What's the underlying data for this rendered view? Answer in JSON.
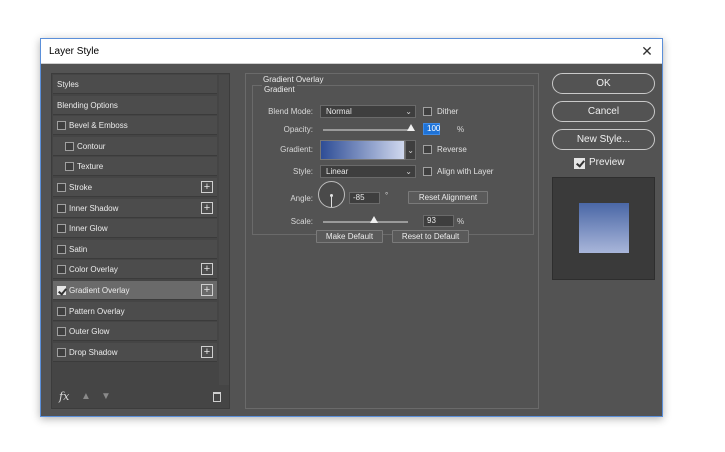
{
  "window": {
    "title": "Layer Style"
  },
  "sidebar": {
    "items": [
      {
        "label": "Styles",
        "checkbox": false,
        "indent": 0,
        "plus": false,
        "active": false
      },
      {
        "label": "Blending Options",
        "checkbox": false,
        "indent": 0,
        "plus": false,
        "active": false
      },
      {
        "label": "Bevel & Emboss",
        "checkbox": true,
        "checked": false,
        "indent": 0,
        "plus": false,
        "active": false
      },
      {
        "label": "Contour",
        "checkbox": true,
        "checked": false,
        "indent": 1,
        "plus": false,
        "active": false
      },
      {
        "label": "Texture",
        "checkbox": true,
        "checked": false,
        "indent": 1,
        "plus": false,
        "active": false
      },
      {
        "label": "Stroke",
        "checkbox": true,
        "checked": false,
        "indent": 0,
        "plus": true,
        "active": false
      },
      {
        "label": "Inner Shadow",
        "checkbox": true,
        "checked": false,
        "indent": 0,
        "plus": true,
        "active": false
      },
      {
        "label": "Inner Glow",
        "checkbox": true,
        "checked": false,
        "indent": 0,
        "plus": false,
        "active": false
      },
      {
        "label": "Satin",
        "checkbox": true,
        "checked": false,
        "indent": 0,
        "plus": false,
        "active": false
      },
      {
        "label": "Color Overlay",
        "checkbox": true,
        "checked": false,
        "indent": 0,
        "plus": true,
        "active": false
      },
      {
        "label": "Gradient Overlay",
        "checkbox": true,
        "checked": true,
        "indent": 0,
        "plus": true,
        "active": true
      },
      {
        "label": "Pattern Overlay",
        "checkbox": true,
        "checked": false,
        "indent": 0,
        "plus": false,
        "active": false
      },
      {
        "label": "Outer Glow",
        "checkbox": true,
        "checked": false,
        "indent": 0,
        "plus": false,
        "active": false
      },
      {
        "label": "Drop Shadow",
        "checkbox": true,
        "checked": false,
        "indent": 0,
        "plus": true,
        "active": false
      }
    ],
    "footer": {
      "fx_label": "fx"
    }
  },
  "panel": {
    "section_title": "Gradient Overlay",
    "subsection_title": "Gradient",
    "blend_mode": {
      "label": "Blend Mode:",
      "value": "Normal"
    },
    "dither": {
      "label": "Dither",
      "checked": false
    },
    "opacity": {
      "label": "Opacity:",
      "value": "100",
      "unit": "%",
      "fraction": 1.0
    },
    "gradient": {
      "label": "Gradient:",
      "start_color": "#2e4d96",
      "end_color": "#d0d8ee"
    },
    "reverse": {
      "label": "Reverse",
      "checked": false
    },
    "style": {
      "label": "Style:",
      "value": "Linear"
    },
    "align_with_layer": {
      "label": "Align with Layer",
      "checked": false
    },
    "angle": {
      "label": "Angle:",
      "value": "-85",
      "unit": "°"
    },
    "reset_alignment_label": "Reset Alignment",
    "scale": {
      "label": "Scale:",
      "value": "93",
      "unit": "%",
      "fraction": 0.6
    },
    "make_default_label": "Make Default",
    "reset_default_label": "Reset to Default"
  },
  "actions": {
    "ok_label": "OK",
    "cancel_label": "Cancel",
    "new_style_label": "New Style...",
    "preview_label": "Preview",
    "preview_checked": true
  }
}
